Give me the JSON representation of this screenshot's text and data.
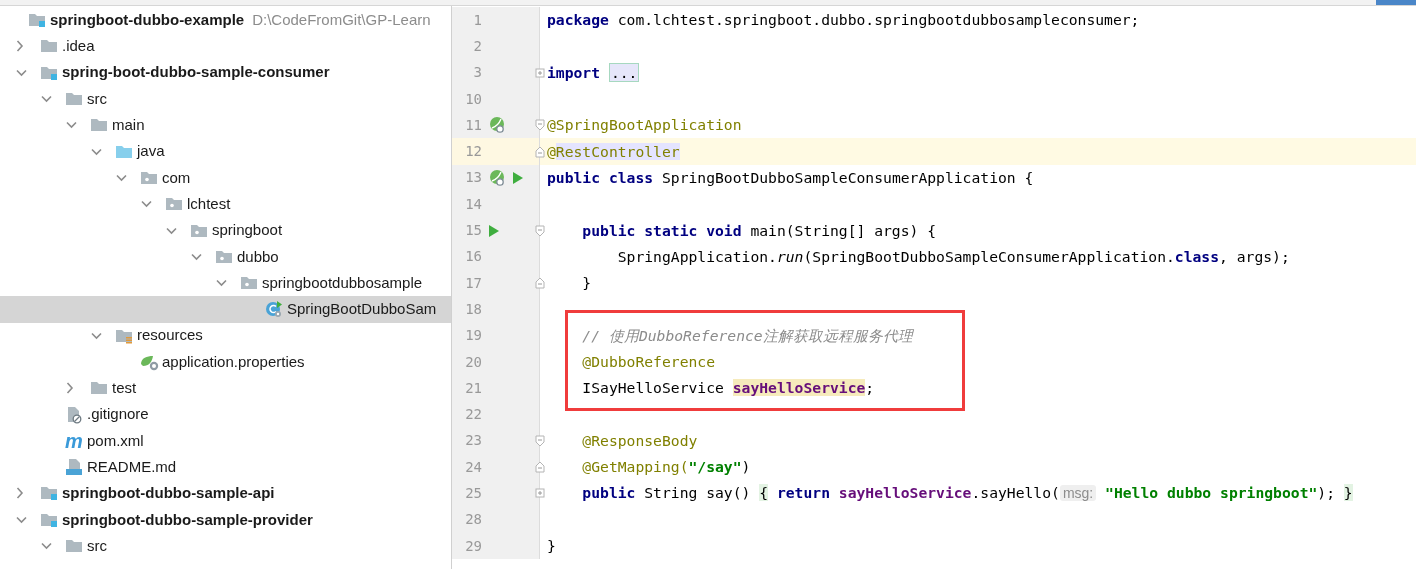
{
  "project_tree": [
    {
      "name": "springboot-dubbo-example",
      "kind": "module",
      "path": "D:\\CodeFromGit\\GP-Learn",
      "selected": false,
      "children": [
        {
          "name": ".idea",
          "kind": "folder",
          "expanded": false,
          "selected": false
        },
        {
          "name": "spring-boot-dubbo-sample-consumer",
          "kind": "module",
          "expanded": true,
          "selected": false,
          "children": [
            {
              "name": "src",
              "kind": "folder",
              "expanded": true,
              "selected": false,
              "children": [
                {
                  "name": "main",
                  "kind": "folder",
                  "expanded": true,
                  "selected": false,
                  "children": [
                    {
                      "name": "java",
                      "kind": "source_root",
                      "expanded": true,
                      "selected": false,
                      "children": [
                        {
                          "name": "com",
                          "kind": "package",
                          "expanded": true,
                          "selected": false,
                          "children": [
                            {
                              "name": "lchtest",
                              "kind": "package",
                              "expanded": true,
                              "selected": false,
                              "children": [
                                {
                                  "name": "springboot",
                                  "kind": "package",
                                  "expanded": true,
                                  "selected": false,
                                  "children": [
                                    {
                                      "name": "dubbo",
                                      "kind": "package",
                                      "expanded": true,
                                      "selected": false,
                                      "children": [
                                        {
                                          "name": "springbootdubbosample",
                                          "kind": "package",
                                          "expanded": true,
                                          "selected": false,
                                          "children": [
                                            {
                                              "name": "SpringBootDubboSam",
                                              "kind": "java_class",
                                              "selected": true
                                            }
                                          ]
                                        }
                                      ]
                                    }
                                  ]
                                }
                              ]
                            }
                          ]
                        }
                      ]
                    },
                    {
                      "name": "resources",
                      "kind": "resource_root",
                      "expanded": true,
                      "selected": false,
                      "children": [
                        {
                          "name": "application.properties",
                          "kind": "spring_properties",
                          "selected": false
                        }
                      ]
                    }
                  ]
                },
                {
                  "name": "test",
                  "kind": "folder",
                  "expanded": false,
                  "selected": false
                }
              ]
            },
            {
              "name": ".gitignore",
              "kind": "gitignore",
              "selected": false
            },
            {
              "name": "pom.xml",
              "kind": "maven_pom",
              "icon_text": "m",
              "selected": false
            },
            {
              "name": "README.md",
              "kind": "markdown",
              "selected": false
            }
          ]
        },
        {
          "name": "springboot-dubbo-sample-api",
          "kind": "module",
          "expanded": false,
          "selected": false
        },
        {
          "name": "springboot-dubbo-sample-provider",
          "kind": "module",
          "expanded": true,
          "selected": false,
          "children": [
            {
              "name": "src",
              "kind": "folder",
              "expanded": true,
              "selected": false
            }
          ]
        }
      ]
    }
  ],
  "editor": {
    "lines": [
      {
        "number": "1",
        "current": false,
        "boxed": false,
        "segments": [
          {
            "text": "package",
            "kind": "keyword",
            "highlighted": false
          },
          {
            "text": " com.lchtest.springboot.dubbo.springbootdubbosampleconsumer;",
            "kind": "plain",
            "highlighted": false
          }
        ]
      },
      {
        "number": "2",
        "current": false,
        "boxed": false
      },
      {
        "number": "3",
        "current": false,
        "boxed": false,
        "fold_marker": {
          "kind": "collapsed"
        },
        "segments": [
          {
            "text": "import ",
            "kind": "keyword",
            "highlighted": false
          },
          {
            "text": "...",
            "kind": "folded",
            "highlighted": false
          }
        ]
      },
      {
        "number": "10",
        "current": false,
        "boxed": false
      },
      {
        "number": "11",
        "current": false,
        "boxed": false,
        "fold_marker": {
          "kind": "start"
        },
        "gutter_icons": [
          {
            "kind": "spring_bean"
          }
        ],
        "segments": [
          {
            "text": "@SpringBootApplication",
            "kind": "annotation",
            "highlighted": false
          }
        ]
      },
      {
        "number": "12",
        "current": true,
        "boxed": false,
        "fold_marker": {
          "kind": "end"
        },
        "segments": [
          {
            "text": "@",
            "kind": "annotation",
            "highlighted": false
          },
          {
            "text": "RestController",
            "kind": "annotation",
            "highlighted": true
          }
        ]
      },
      {
        "number": "13",
        "current": false,
        "boxed": false,
        "gutter_icons": [
          {
            "kind": "spring_bean"
          },
          {
            "kind": "run"
          }
        ],
        "segments": [
          {
            "text": "public class",
            "kind": "keyword",
            "highlighted": false
          },
          {
            "text": " SpringBootDubboSampleConsumerApplication {",
            "kind": "plain",
            "highlighted": false
          }
        ]
      },
      {
        "number": "14",
        "current": false,
        "boxed": false
      },
      {
        "number": "15",
        "current": false,
        "boxed": false,
        "fold_marker": {
          "kind": "start"
        },
        "gutter_icons": [
          {
            "kind": "run"
          }
        ],
        "segments": [
          {
            "text": "    public static void",
            "kind": "keyword",
            "highlighted": false
          },
          {
            "text": " main(String[] args) {",
            "kind": "plain",
            "highlighted": false
          }
        ]
      },
      {
        "number": "16",
        "current": false,
        "boxed": false,
        "segments": [
          {
            "text": "        SpringApplication.",
            "kind": "plain",
            "highlighted": false
          },
          {
            "text": "run",
            "kind": "static_call",
            "highlighted": false
          },
          {
            "text": "(SpringBootDubboSampleConsumerApplication.",
            "kind": "plain",
            "highlighted": false
          },
          {
            "text": "class",
            "kind": "keyword",
            "highlighted": false
          },
          {
            "text": ", args);",
            "kind": "plain",
            "highlighted": false
          }
        ]
      },
      {
        "number": "17",
        "current": false,
        "boxed": false,
        "fold_marker": {
          "kind": "end"
        },
        "segments": [
          {
            "text": "    }",
            "kind": "plain",
            "highlighted": false
          }
        ]
      },
      {
        "number": "18",
        "current": false,
        "boxed": false
      },
      {
        "number": "19",
        "current": false,
        "boxed": true,
        "segments": [
          {
            "text": "    // 使用DubboReference注解获取远程服务代理",
            "kind": "comment",
            "highlighted": false
          }
        ]
      },
      {
        "number": "20",
        "current": false,
        "boxed": true,
        "segments": [
          {
            "text": "    @DubboReference",
            "kind": "annotation",
            "highlighted": false
          }
        ]
      },
      {
        "number": "21",
        "current": false,
        "boxed": true,
        "segments": [
          {
            "text": "    ISayHelloService ",
            "kind": "plain",
            "highlighted": false
          },
          {
            "text": "sayHelloService",
            "kind": "field",
            "highlighted": true
          },
          {
            "text": ";",
            "kind": "plain",
            "highlighted": false
          }
        ]
      },
      {
        "number": "22",
        "current": false,
        "boxed": false
      },
      {
        "number": "23",
        "current": false,
        "boxed": false,
        "fold_marker": {
          "kind": "start"
        },
        "segments": [
          {
            "text": "    @ResponseBody",
            "kind": "annotation",
            "highlighted": false
          }
        ]
      },
      {
        "number": "24",
        "current": false,
        "boxed": false,
        "fold_marker": {
          "kind": "end"
        },
        "segments": [
          {
            "text": "    @GetMapping(",
            "kind": "annotation",
            "highlighted": false
          },
          {
            "text": "\"/say\"",
            "kind": "string",
            "highlighted": false
          },
          {
            "text": ")",
            "kind": "plain",
            "highlighted": false
          }
        ]
      },
      {
        "number": "25",
        "current": false,
        "boxed": false,
        "fold_marker": {
          "kind": "collapsed"
        },
        "segments": [
          {
            "text": "    public",
            "kind": "keyword",
            "highlighted": false
          },
          {
            "text": " String say() ",
            "kind": "plain",
            "highlighted": false
          },
          {
            "text": "{",
            "kind": "plain",
            "highlighted": true
          },
          {
            "text": " return ",
            "kind": "keyword",
            "highlighted": false
          },
          {
            "text": "sayHelloService",
            "kind": "field",
            "highlighted": false
          },
          {
            "text": ".sayHello(",
            "kind": "plain",
            "highlighted": false
          },
          {
            "text": "msg:",
            "kind": "hint",
            "highlighted": false
          },
          {
            "text": " \"Hello dubbo springboot\"",
            "kind": "string",
            "highlighted": false
          },
          {
            "text": "); ",
            "kind": "plain",
            "highlighted": false
          },
          {
            "text": "}",
            "kind": "plain",
            "highlighted": true
          }
        ]
      },
      {
        "number": "28",
        "current": false,
        "boxed": false
      },
      {
        "number": "29",
        "current": false,
        "boxed": false,
        "segments": [
          {
            "text": "}",
            "kind": "plain",
            "highlighted": false
          }
        ]
      }
    ]
  }
}
